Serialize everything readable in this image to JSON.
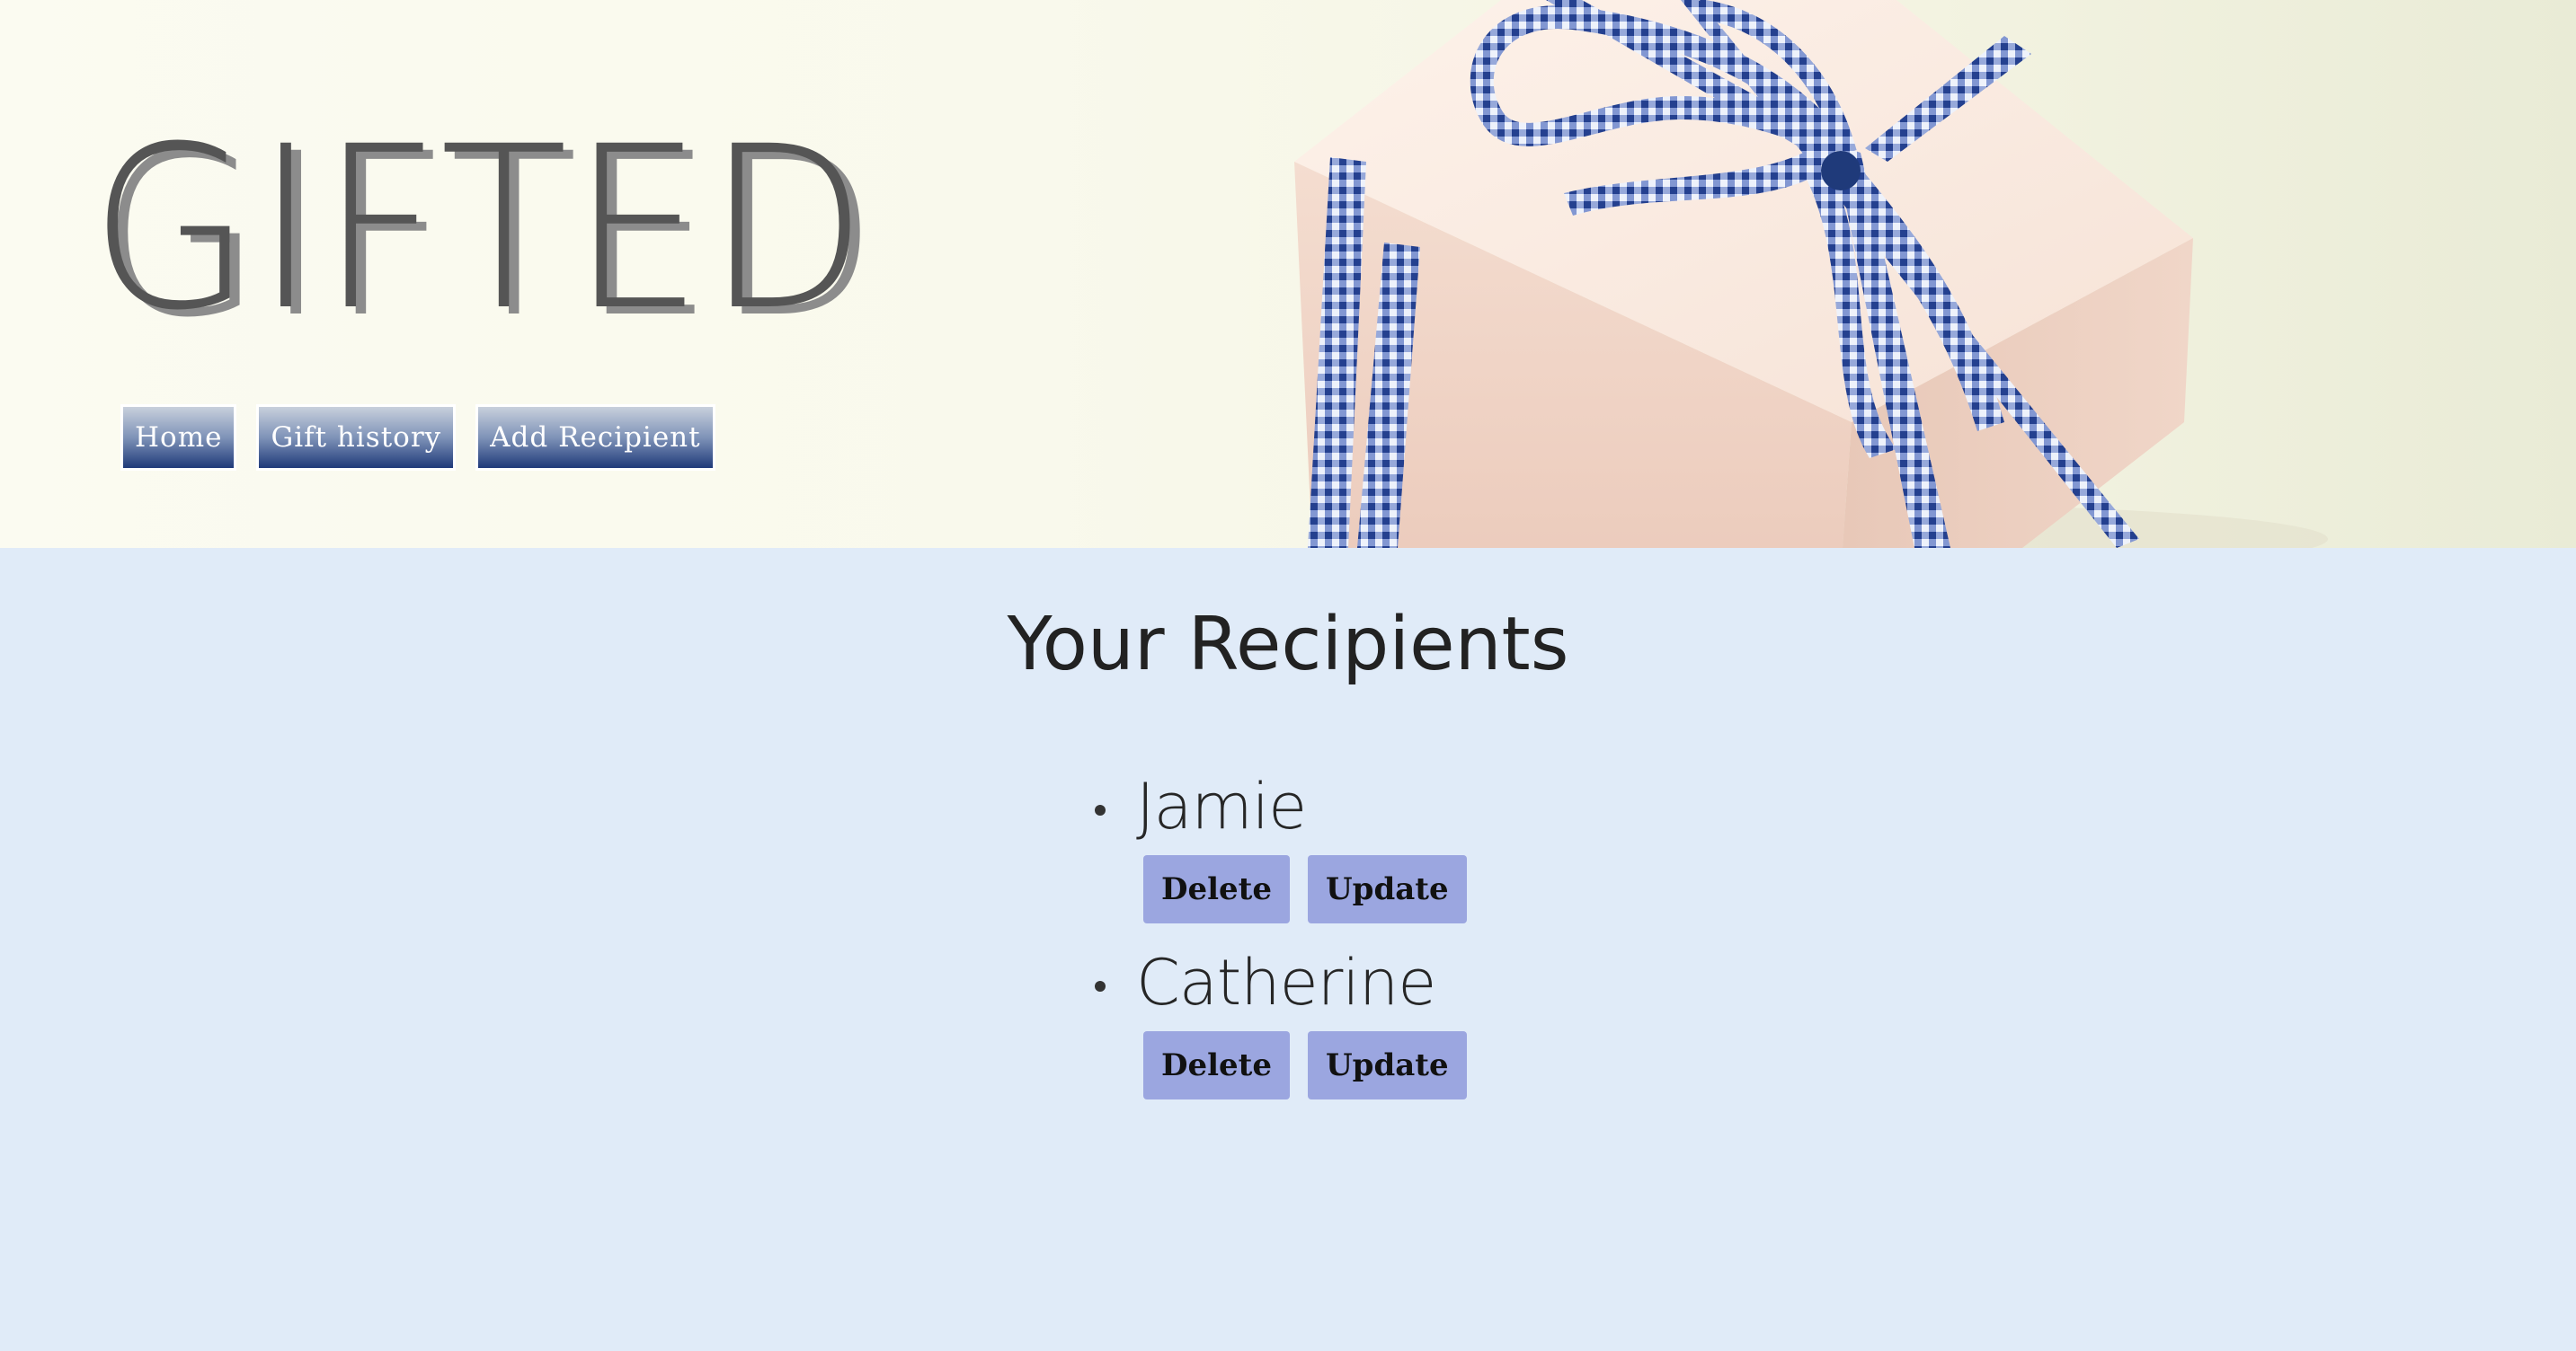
{
  "header": {
    "brand": "GIFTED",
    "nav": [
      {
        "label": "Home"
      },
      {
        "label": "Gift history"
      },
      {
        "label": "Add Recipient"
      }
    ],
    "hero_image": "gift-box-with-blue-gingham-ribbon"
  },
  "main": {
    "title": "Your Recipients",
    "recipients": [
      {
        "name": "Jamie",
        "delete_label": "Delete",
        "update_label": "Update"
      },
      {
        "name": "Catherine",
        "delete_label": "Delete",
        "update_label": "Update"
      }
    ]
  },
  "colors": {
    "page_background": "#e0ebf8",
    "action_button": "#9ba6e0",
    "nav_button_dark": "#1f3a7a",
    "ribbon": "#2f4f9e"
  }
}
